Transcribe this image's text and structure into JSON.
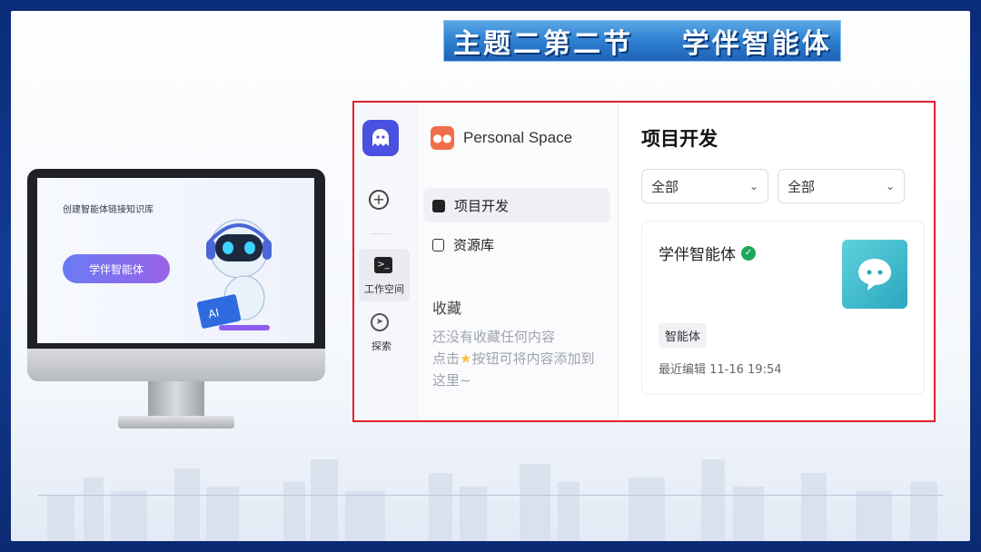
{
  "slide": {
    "title": "主题二第二节    学伴智能体"
  },
  "monitor": {
    "caption": "创建智能体链接知识库",
    "button_label": "学伴智能体",
    "robot_screen_text": "AI"
  },
  "app": {
    "rail": {
      "workspace_label": "工作空间",
      "explore_label": "探索"
    },
    "sidebar": {
      "space_name": "Personal Space",
      "items": [
        {
          "label": "项目开发",
          "active": true
        },
        {
          "label": "资源库",
          "active": false
        }
      ],
      "favorites_title": "收藏",
      "favorites_empty_line1": "还没有收藏任何内容",
      "favorites_empty_line2_prefix": "点击",
      "favorites_empty_line2_suffix": "按钮可将内容添加到",
      "favorites_empty_line3": "这里~"
    },
    "main": {
      "title": "项目开发",
      "filters": [
        {
          "value": "全部"
        },
        {
          "value": "全部"
        }
      ],
      "card": {
        "name": "学伴智能体",
        "badge": "智能体",
        "edited": "最近编辑 11-16 19:54"
      }
    }
  },
  "colors": {
    "frame_border": "#e0202a",
    "logo": "#4a51e0",
    "space_icon": "#ef6f4a",
    "verified": "#1ea85a",
    "slide_bg": "#0a2b78"
  }
}
